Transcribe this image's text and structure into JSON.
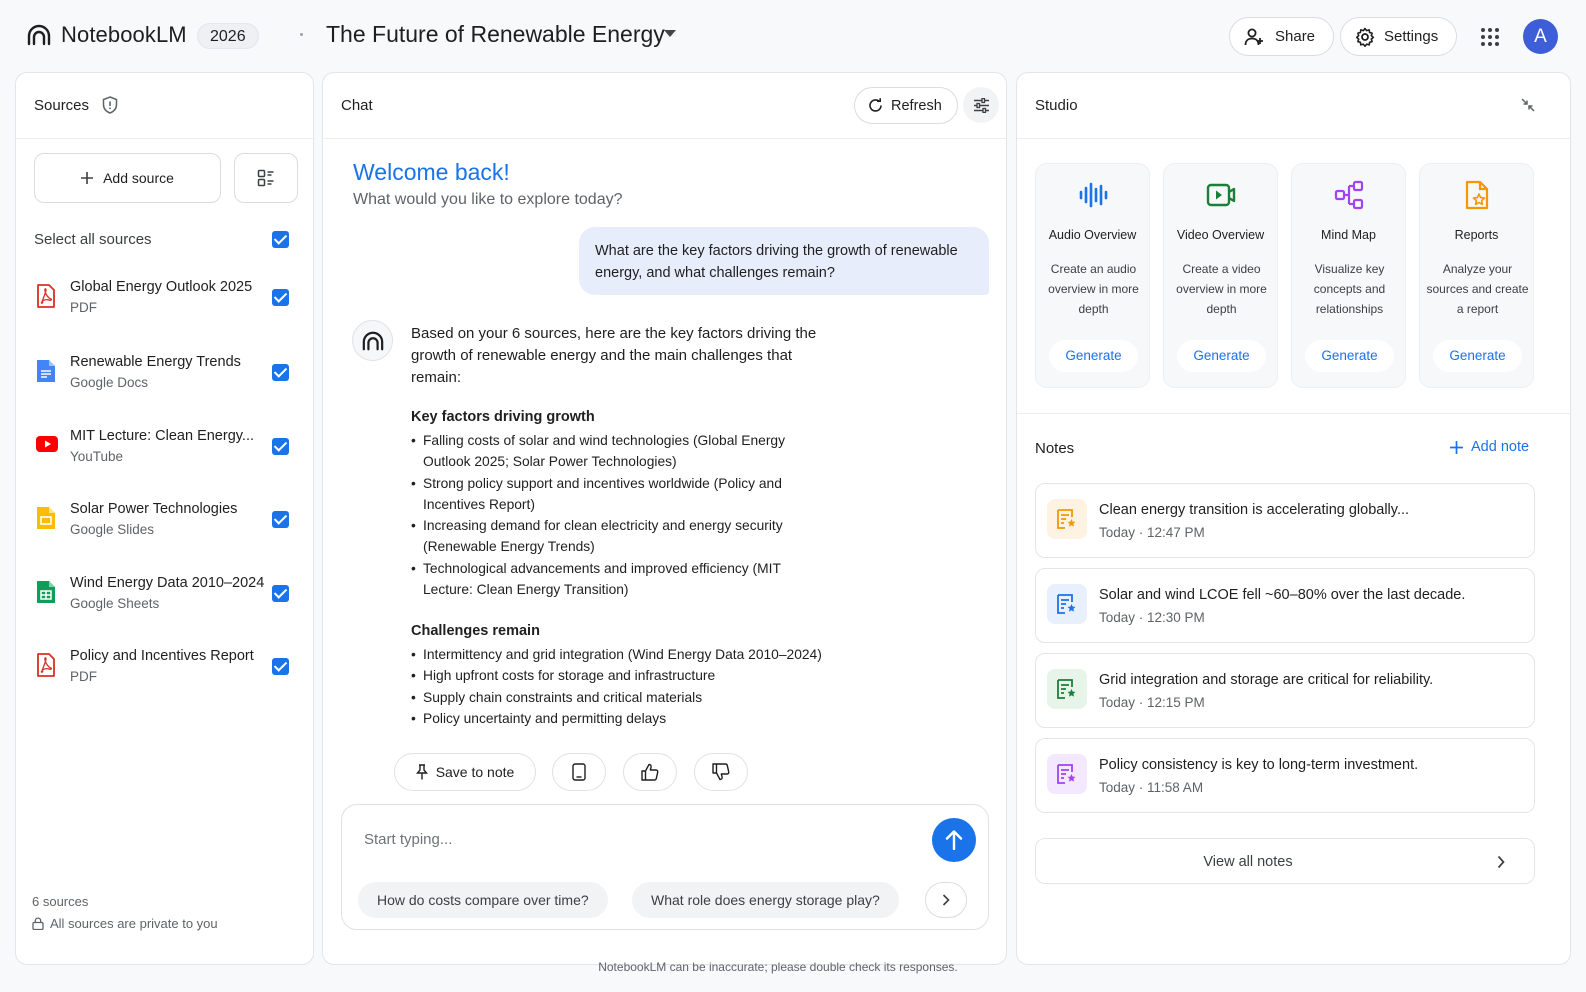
{
  "header": {
    "app_name": "NotebookLM",
    "year_badge": "2026",
    "notebook_title": "The Future of Renewable Energy",
    "share_label": "Share",
    "settings_label": "Settings",
    "avatar_initial": "A"
  },
  "sources": {
    "title": "Sources",
    "add_source_label": "Add source",
    "select_all_label": "Select all sources",
    "select_all_checked": true,
    "items": [
      {
        "name": "Global Energy Outlook 2025",
        "type": "PDF",
        "icon": "pdf-icon",
        "checked": true
      },
      {
        "name": "Renewable Energy Trends",
        "type": "Google Docs",
        "icon": "google-docs-icon",
        "checked": true
      },
      {
        "name": "MIT Lecture: Clean Energy...",
        "type": "YouTube",
        "icon": "youtube-icon",
        "checked": true
      },
      {
        "name": "Solar Power Technologies",
        "type": "Google Slides",
        "icon": "google-slides-icon",
        "checked": true
      },
      {
        "name": "Wind Energy Data 2010–2024",
        "type": "Google Sheets",
        "icon": "google-sheets-icon",
        "checked": true
      },
      {
        "name": "Policy and Incentives Report",
        "type": "PDF",
        "icon": "pdf-icon",
        "checked": true
      }
    ],
    "count_label": "6 sources",
    "private_note": "All sources are private to you"
  },
  "chat": {
    "title": "Chat",
    "refresh_label": "Refresh",
    "welcome_title": "Welcome back!",
    "welcome_subtitle": "What would you like to explore today?",
    "user_message": "What are the key factors driving the growth of renewable energy, and what challenges remain?",
    "bot_intro": "Based on your 6 sources, here are the key factors driving the growth of renewable energy and the main challenges that remain:",
    "section1_heading": "Key factors driving growth",
    "section1_items": [
      "Falling costs of solar and wind technologies (Global Energy Outlook 2025; Solar Power Technologies)",
      "Strong policy support and incentives worldwide (Policy and Incentives Report)",
      "Increasing demand for clean electricity and energy security (Renewable Energy Trends)",
      "Technological advancements and improved efficiency (MIT Lecture: Clean Energy Transition)"
    ],
    "section2_heading": "Challenges remain",
    "section2_items": [
      "Intermittency and grid integration (Wind Energy Data 2010–2024)",
      "High upfront costs for storage and infrastructure",
      "Supply chain constraints and critical materials",
      "Policy uncertainty and permitting delays"
    ],
    "save_to_note_label": "Save to note",
    "input_placeholder": "Start typing...",
    "suggestions": [
      "How do costs compare over time?",
      "What role does energy storage play?"
    ]
  },
  "studio": {
    "title": "Studio",
    "tiles": [
      {
        "title": "Audio Overview",
        "desc": "Create an audio overview in more depth",
        "button": "Generate",
        "icon": "audio-waveform-icon",
        "color": "#1a73e8"
      },
      {
        "title": "Video Overview",
        "desc": "Create a video overview in more depth",
        "button": "Generate",
        "icon": "video-play-icon",
        "color": "#188038"
      },
      {
        "title": "Mind Map",
        "desc": "Visualize key concepts and relationships",
        "button": "Generate",
        "icon": "mind-map-icon",
        "color": "#a142f4"
      },
      {
        "title": "Reports",
        "desc": "Analyze your sources and create a report",
        "button": "Generate",
        "icon": "report-icon",
        "color": "#f29900"
      }
    ],
    "notes_title": "Notes",
    "add_note_label": "Add note",
    "notes": [
      {
        "text": "Clean energy transition is accelerating globally...",
        "time": "Today · 12:47 PM",
        "color": "#f29900",
        "bg": "#fef3e2"
      },
      {
        "text": "Solar and wind LCOE fell ~60–80% over the last decade.",
        "time": "Today · 12:30 PM",
        "color": "#1a73e8",
        "bg": "#e8f0fe"
      },
      {
        "text": "Grid integration and storage are critical for reliability.",
        "time": "Today · 12:15 PM",
        "color": "#188038",
        "bg": "#e6f4ea"
      },
      {
        "text": "Policy consistency is key to long-term investment.",
        "time": "Today · 11:58 AM",
        "color": "#a142f4",
        "bg": "#f3e8fd"
      }
    ],
    "view_all_label": "View all notes"
  },
  "footer": {
    "disclaimer": "NotebookLM can be inaccurate; please double check its responses."
  }
}
